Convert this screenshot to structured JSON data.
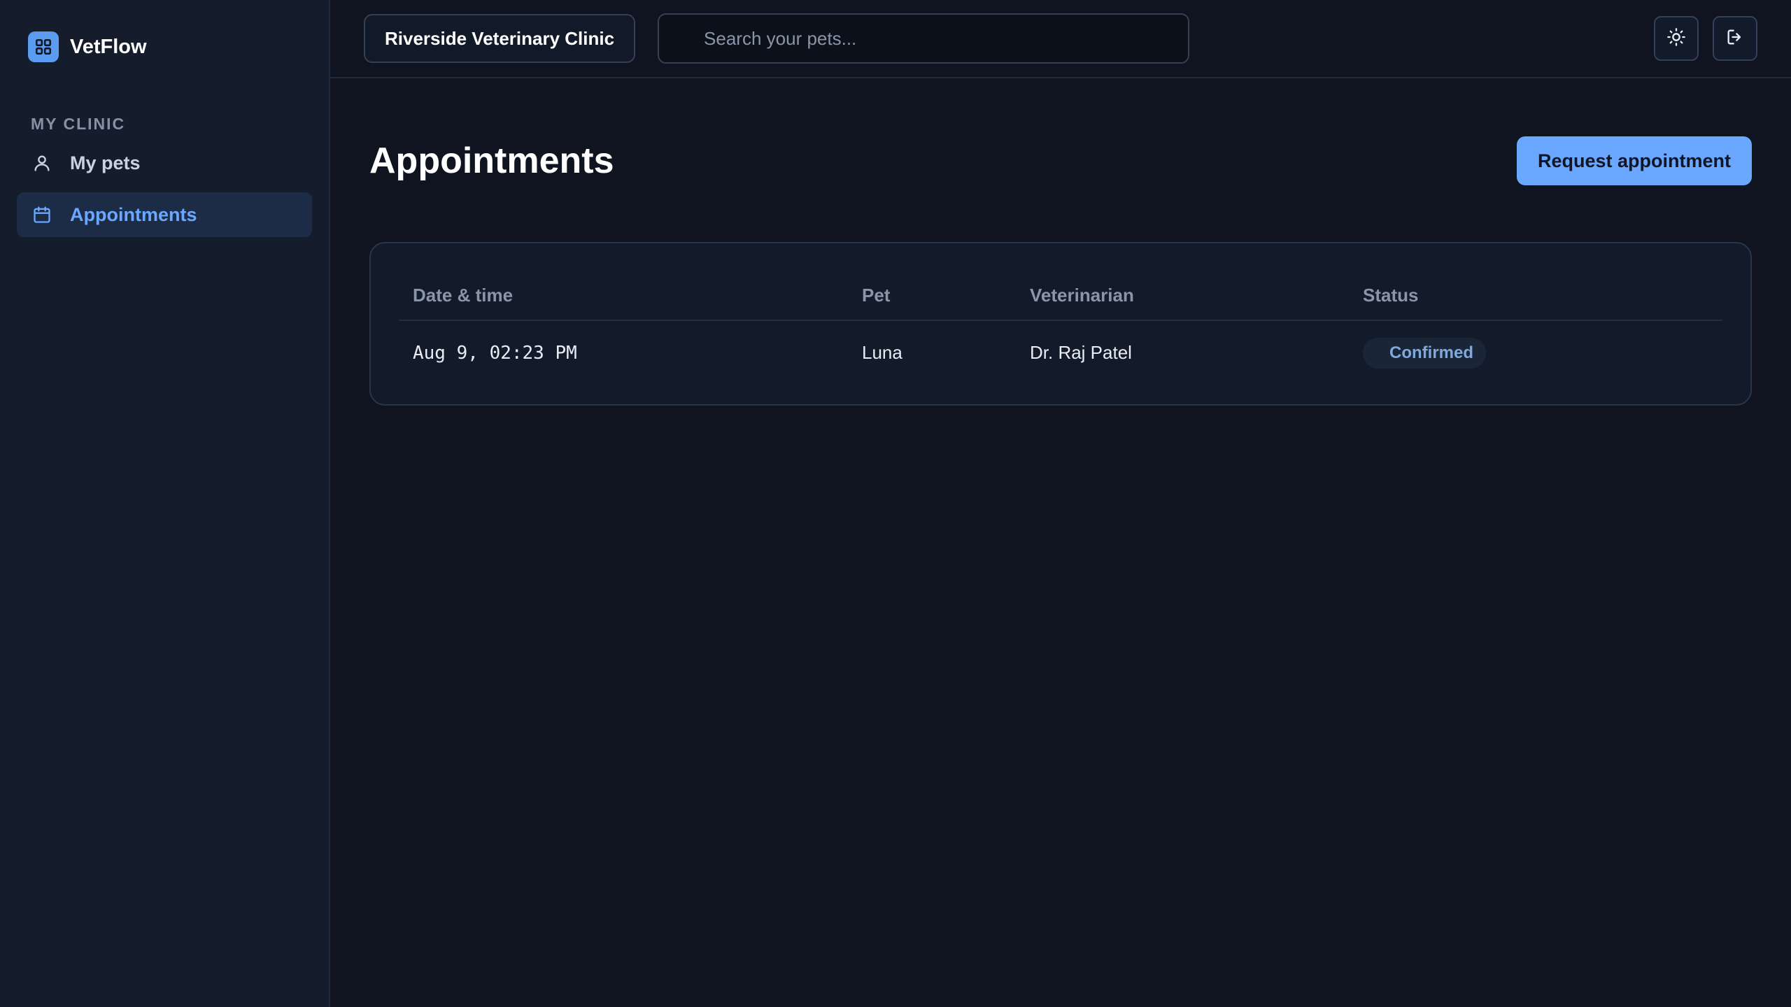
{
  "brand": {
    "name": "VetFlow",
    "icon": "grid-icon"
  },
  "sidebar": {
    "section_label": "MY CLINIC",
    "items": [
      {
        "label": "My pets",
        "icon": "user-icon",
        "active": false
      },
      {
        "label": "Appointments",
        "icon": "calendar-icon",
        "active": true
      }
    ]
  },
  "topbar": {
    "clinic_name": "Riverside Veterinary Clinic",
    "search_placeholder": "Search your pets...",
    "actions": [
      "sun-icon",
      "logout-icon"
    ]
  },
  "page": {
    "title": "Appointments",
    "primary_action": "Request appointment"
  },
  "table": {
    "columns": [
      "Date & time",
      "Pet",
      "Veterinarian",
      "Status"
    ],
    "rows": [
      {
        "datetime": "Aug 9, 02:23 PM",
        "pet": "Luna",
        "vet": "Dr. Raj Patel",
        "status": "Confirmed"
      }
    ]
  },
  "colors": {
    "accent": "#6aa7ff",
    "sidebar_bg": "#151d2d",
    "main_bg": "#0f1420",
    "status_confirmed": "#7fa9db"
  }
}
